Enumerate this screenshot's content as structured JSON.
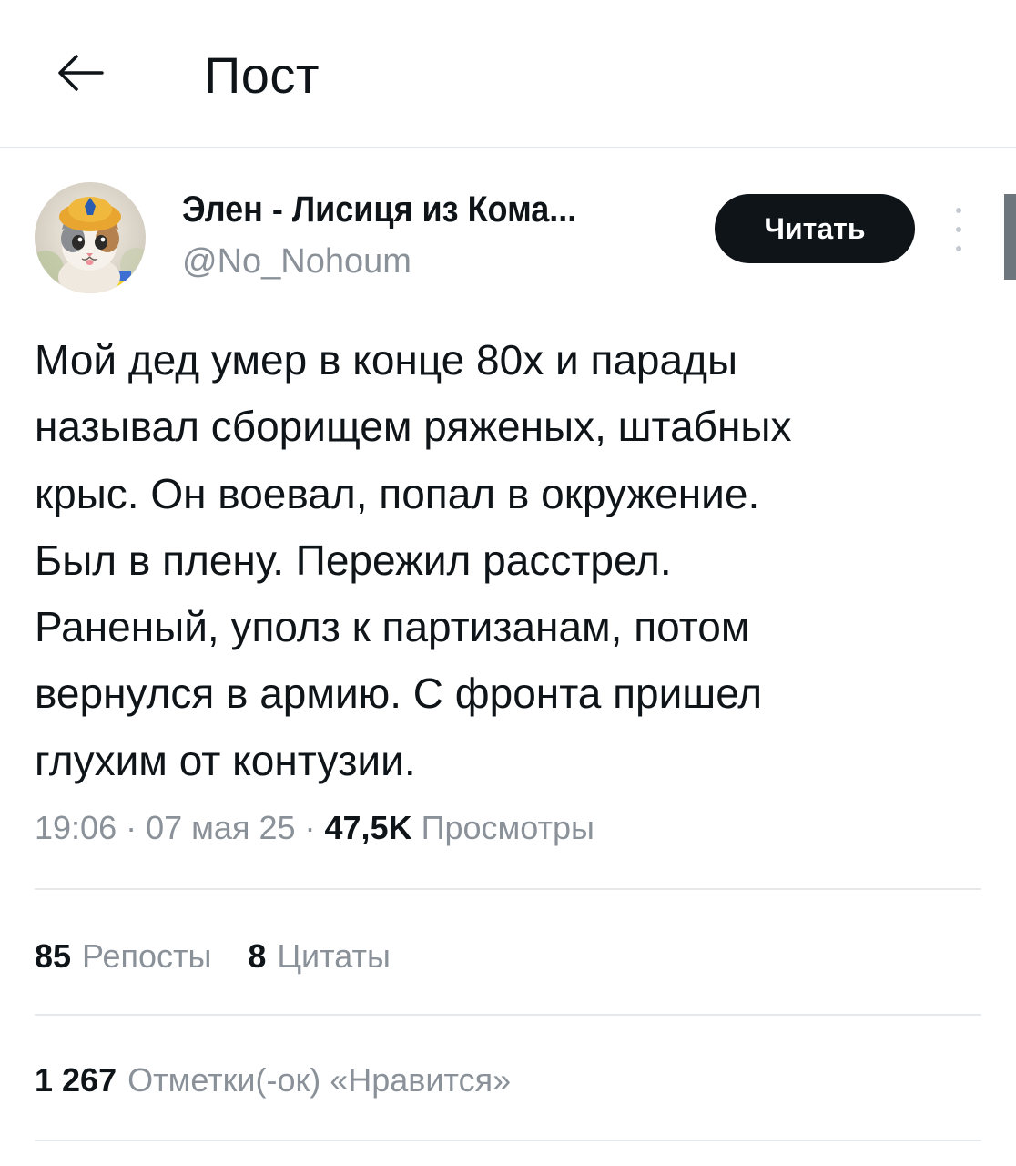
{
  "header": {
    "title": "Пост"
  },
  "author": {
    "name": "Элен - Лисиця из Кома...",
    "handle": "@No_Nohoum",
    "follow_label": "Читать"
  },
  "post": {
    "text": "Мой дед умер в конце 80х и парады\nназывал сборищем ряженых, штабных\nкрыс. Он воевал, попал в окружение.\nБыл в плену. Пережил расстрел.\nРаненый, уполз к партизанам, потом\nвернулся в армию. С фронта пришел\nглухим от контузии."
  },
  "meta": {
    "time": "19:06",
    "date": "07 мая 25",
    "views_count": "47,5K",
    "views_label": "Просмотры",
    "separator": "·"
  },
  "stats": {
    "reposts_count": "85",
    "reposts_label": "Репосты",
    "quotes_count": "8",
    "quotes_label": "Цитаты",
    "likes_count": "1 267",
    "likes_label": "Отметки(-ок) «Нравится»"
  },
  "colors": {
    "text_primary": "#0f1419",
    "text_secondary": "#8a9199",
    "divider": "#e6e9ec",
    "button_bg": "#0f1419",
    "button_text": "#ffffff"
  },
  "icons": {
    "back": "arrow-left-icon",
    "more": "more-vertical-icon"
  }
}
